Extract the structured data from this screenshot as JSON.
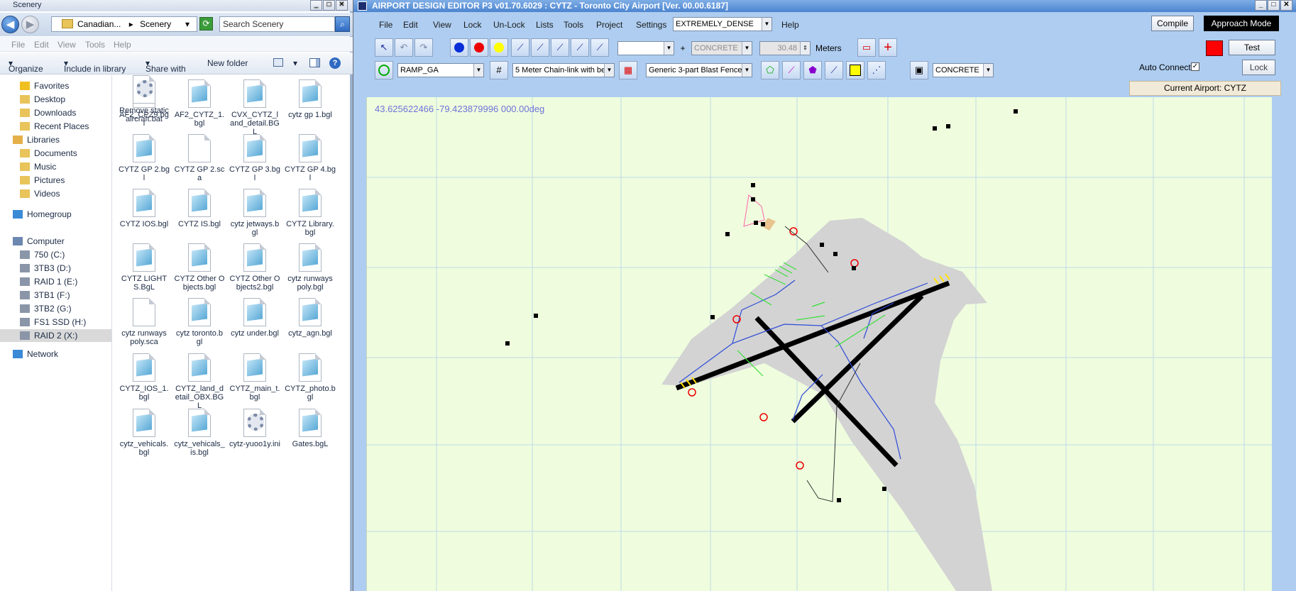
{
  "explorer": {
    "title": "Scenery",
    "path": "Canadian...",
    "path_leaf": "Scenery",
    "search_placeholder": "Search Scenery",
    "menu": [
      "File",
      "Edit",
      "View",
      "Tools",
      "Help"
    ],
    "commands": [
      "Organize",
      "Include in library",
      "Share with",
      "New folder"
    ],
    "nav": {
      "favorites": "Favorites",
      "fav_items": [
        "Desktop",
        "Downloads",
        "Recent Places"
      ],
      "libraries": "Libraries",
      "lib_items": [
        "Documents",
        "Music",
        "Pictures",
        "Videos"
      ],
      "homegroup": "Homegroup",
      "computer": "Computer",
      "drives": [
        "750 (C:)",
        "3TB3 (D:)",
        "RAID 1 (E:)",
        "3TB1 (F:)",
        "3TB2 (G:)",
        "FS1 SSD (H:)",
        "RAID 2 (X:)"
      ],
      "network": "Network"
    },
    "files": [
      {
        "name": "AF2_CPZ9.bgl",
        "icon": "bgl"
      },
      {
        "name": "AF2_CYTZ_1.bgl",
        "icon": "bgl"
      },
      {
        "name": "CVX_CYTZ_land_detail.BGL",
        "icon": "bgl"
      },
      {
        "name": "cytz gp 1.bgl",
        "icon": "bgl"
      },
      {
        "name": "CYTZ GP 2.bgl",
        "icon": "bgl"
      },
      {
        "name": "CYTZ GP 2.sca",
        "icon": "blank"
      },
      {
        "name": "CYTZ GP 3.bgl",
        "icon": "bgl"
      },
      {
        "name": "CYTZ GP 4.bgl",
        "icon": "bgl"
      },
      {
        "name": "CYTZ IOS.bgl",
        "icon": "bgl"
      },
      {
        "name": "CYTZ IS.bgl",
        "icon": "bgl"
      },
      {
        "name": "cytz jetways.bgl",
        "icon": "bgl"
      },
      {
        "name": "CYTZ Library.bgl",
        "icon": "bgl"
      },
      {
        "name": "CYTZ LIGHTS.BgL",
        "icon": "bgl"
      },
      {
        "name": "CYTZ Other Objects.bgl",
        "icon": "bgl"
      },
      {
        "name": "CYTZ Other Objects2.bgl",
        "icon": "bgl"
      },
      {
        "name": "cytz runways poly.bgl",
        "icon": "bgl"
      },
      {
        "name": "cytz runways poly.sca",
        "icon": "blank"
      },
      {
        "name": "cytz toronto.bgl",
        "icon": "bgl"
      },
      {
        "name": "cytz under.bgl",
        "icon": "bgl"
      },
      {
        "name": "cytz_agn.bgl",
        "icon": "bgl"
      },
      {
        "name": "CYTZ_IOS_1.bgl",
        "icon": "bgl"
      },
      {
        "name": "CYTZ_land_detail_OBX.BGL",
        "icon": "bgl"
      },
      {
        "name": "CYTZ_main_t.bgl",
        "icon": "bgl"
      },
      {
        "name": "CYTZ_photo.bgl",
        "icon": "bgl"
      },
      {
        "name": "cytz_vehicals.bgl",
        "icon": "bgl"
      },
      {
        "name": "cytz_vehicals_is.bgl",
        "icon": "bgl"
      },
      {
        "name": "cytz-yuoo1y.ini",
        "icon": "ini"
      },
      {
        "name": "Gates.bgL",
        "icon": "bgl"
      },
      {
        "name": "Remove static aircraft.bat",
        "icon": "bat"
      }
    ]
  },
  "ade": {
    "title": "AIRPORT DESIGN EDITOR P3  v01.70.6029 : CYTZ - Toronto City Airport [Ver. 00.00.6187]",
    "menu": [
      "File",
      "Edit",
      "View",
      "Lock",
      "Un-Lock",
      "Lists",
      "Tools",
      "Project",
      "Settings"
    ],
    "density": "EXTREMELY_DENSE",
    "help": "Help",
    "compile": "Compile",
    "approach_mode": "Approach Mode",
    "test": "Test",
    "lock": "Lock",
    "auto_connect": "Auto Connect",
    "current_airport": "Current Airport: CYTZ",
    "surface_disabled": "CONCRETE",
    "width_value": "30.48",
    "units": "Meters",
    "ramp": "RAMP_GA",
    "fence": "5 Meter Chain-link with be",
    "blast_fence": "Generic 3-part Blast Fence",
    "surface": "CONCRETE",
    "plus": "+",
    "coords": "43.625622466   -79.423879996 000.00deg",
    "accent_red": "#ff0000",
    "canvas_bg": "#effdde"
  }
}
